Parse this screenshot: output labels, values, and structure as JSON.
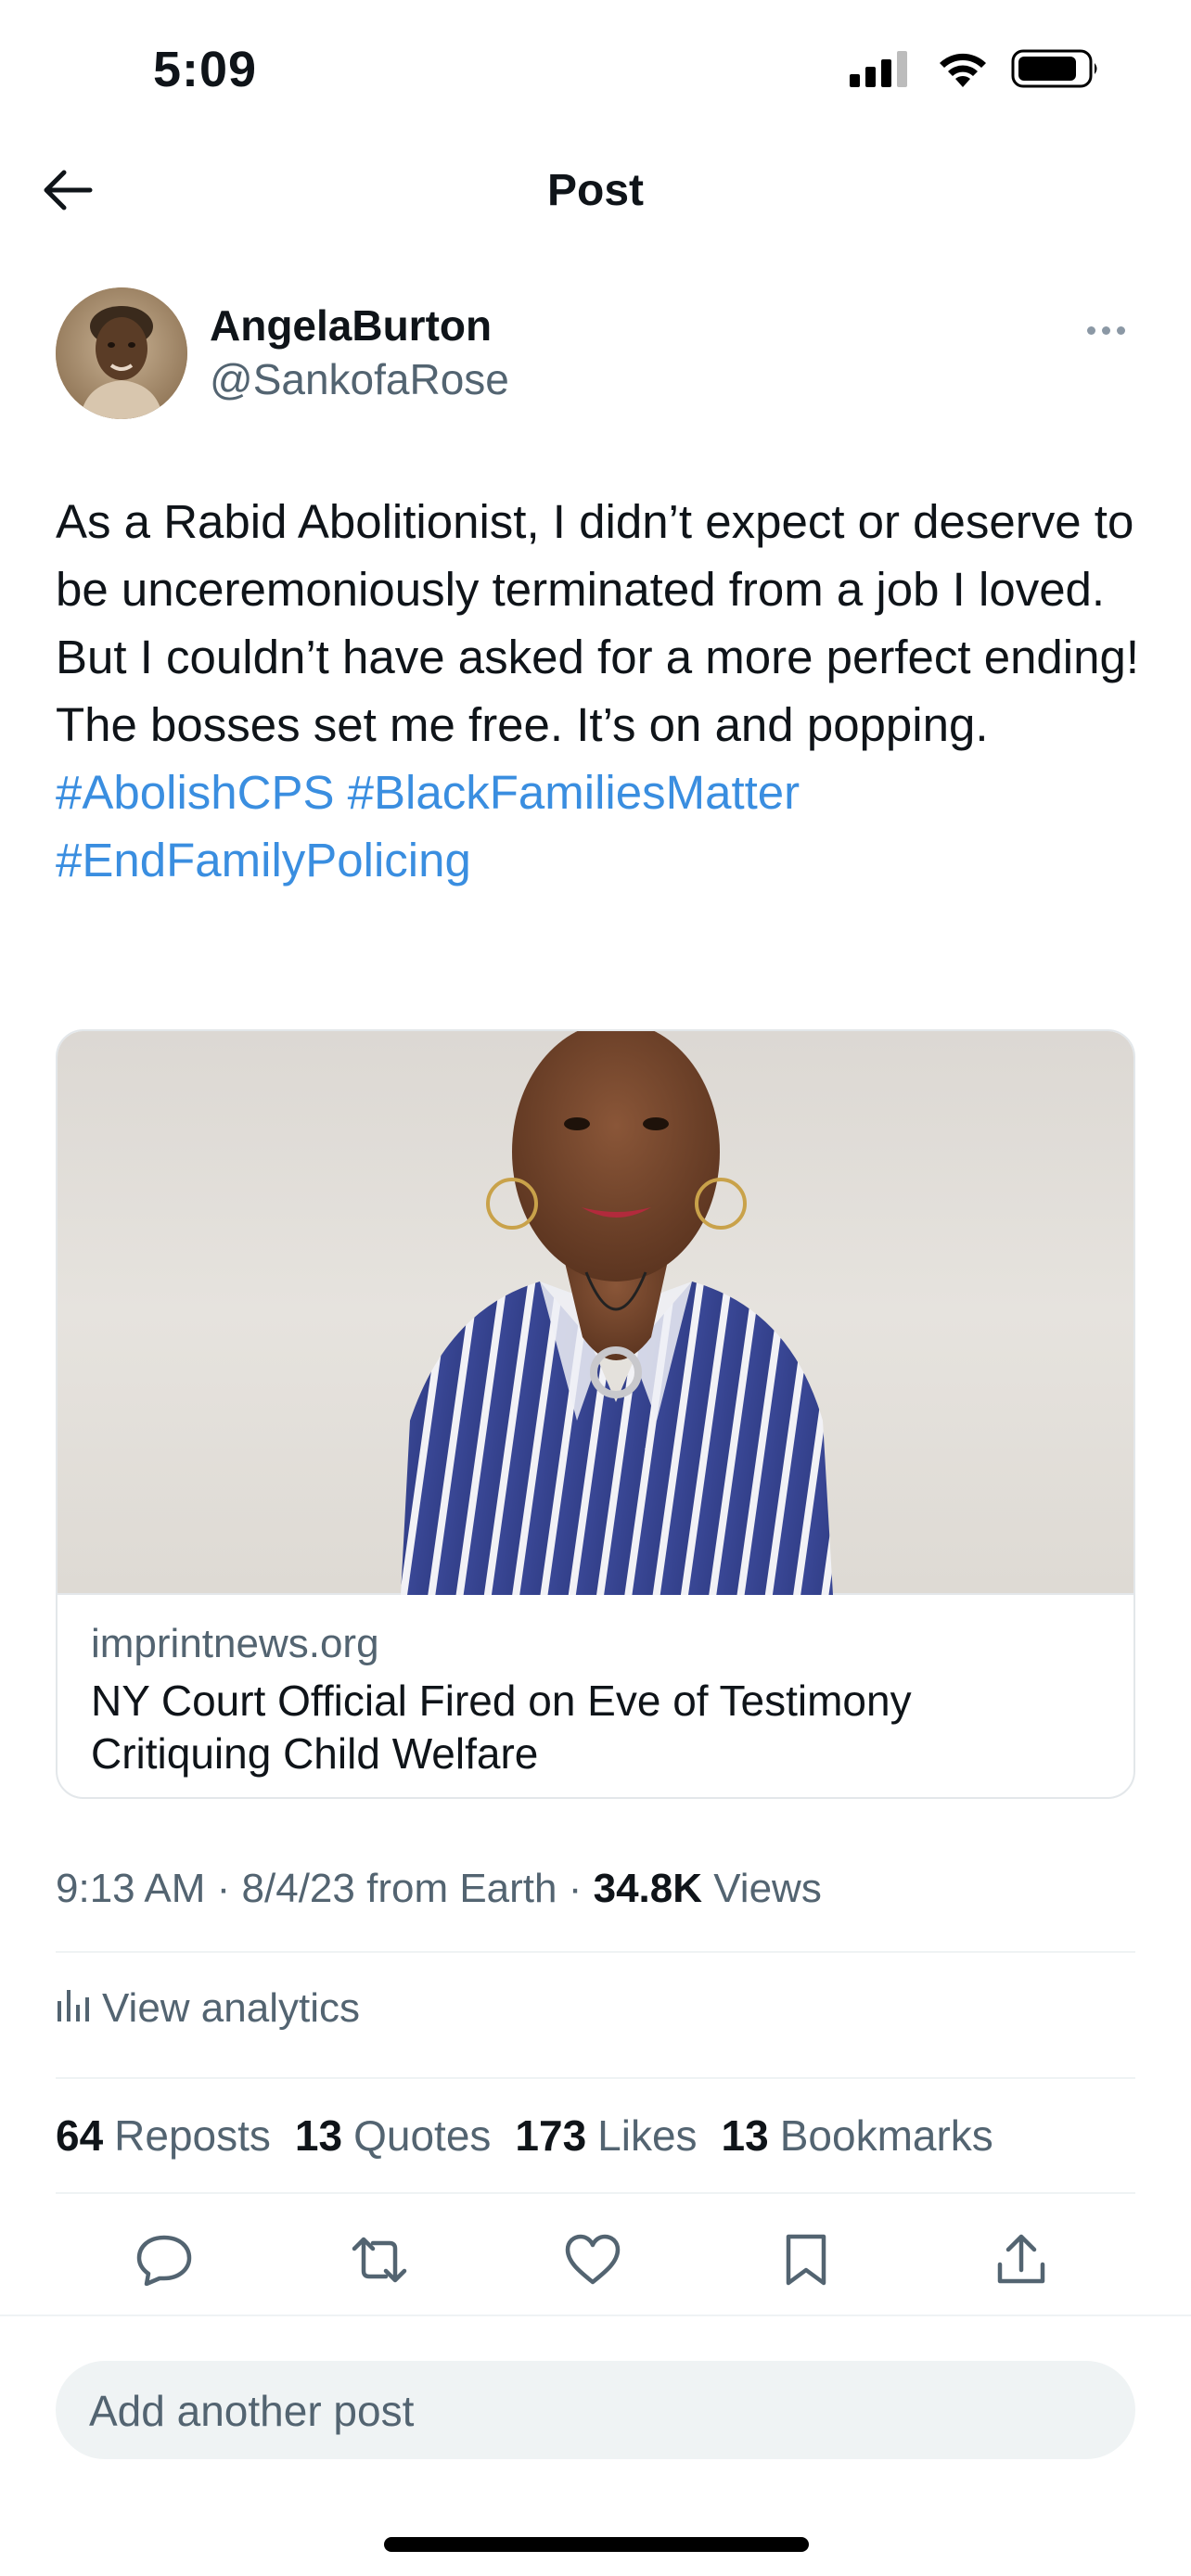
{
  "status_bar": {
    "time": "5:09",
    "icons": [
      "signal-icon",
      "wifi-icon",
      "battery-icon"
    ]
  },
  "nav": {
    "title": "Post",
    "back_icon": "back-arrow-icon"
  },
  "author": {
    "display_name": "AngelaBurton",
    "handle": "@SankofaRose",
    "more_icon": "more-icon"
  },
  "post": {
    "text_plain": "As a Rabid Abolitionist, I didn’t expect or deserve to be unceremoniously terminated from a job I loved.\nBut I couldn’t have asked for a more perfect ending! The bosses set me free. It’s on and popping. ",
    "hashtags": [
      "#AbolishCPS",
      "#BlackFamiliesMatter",
      "#EndFamilyPolicing"
    ]
  },
  "link_card": {
    "domain": "imprintnews.org",
    "title": "NY Court Official Fired on Eve of Testimony Critiquing Child Welfare"
  },
  "meta": {
    "time_date": "9:13 AM · 8/4/23 from Earth · ",
    "views_count": "34.8K",
    "views_label": " Views"
  },
  "analytics": {
    "label": "View analytics",
    "icon": "analytics-icon"
  },
  "stats": [
    {
      "count": "64",
      "label": "Reposts"
    },
    {
      "count": "13",
      "label": "Quotes"
    },
    {
      "count": "173",
      "label": "Likes"
    },
    {
      "count": "13",
      "label": "Bookmarks"
    }
  ],
  "actions": [
    "reply-icon",
    "repost-icon",
    "like-icon",
    "bookmark-icon",
    "share-icon"
  ],
  "reply_box": {
    "placeholder": "Add another post"
  },
  "colors": {
    "text": "#0f1419",
    "secondary": "#536471",
    "hashtag": "#3a8ee0",
    "divider": "#eff3f4"
  }
}
